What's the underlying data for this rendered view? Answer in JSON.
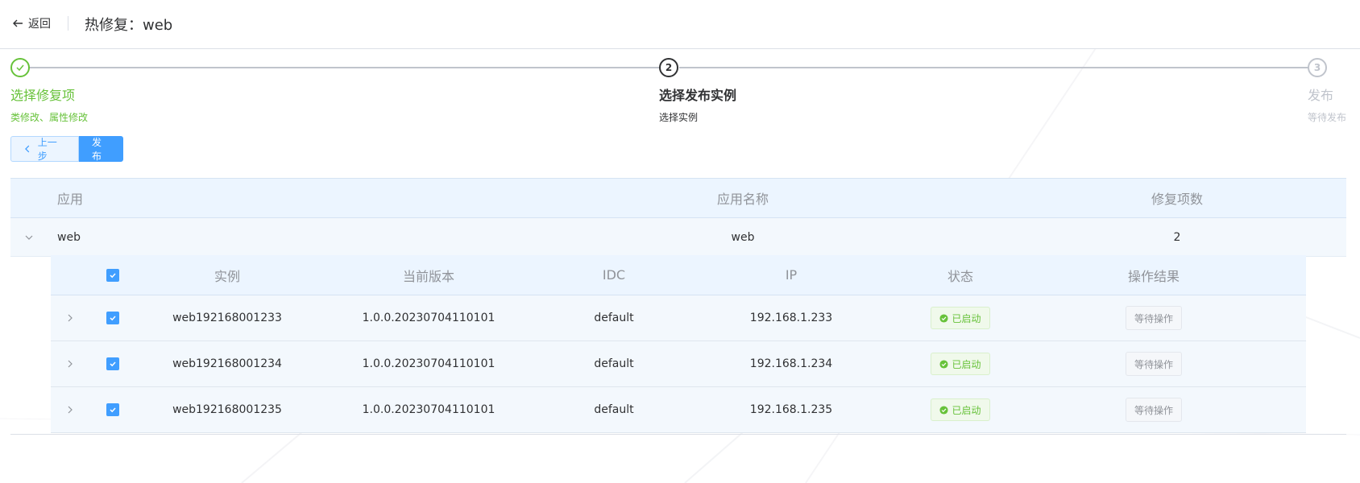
{
  "header": {
    "back_label": "返回",
    "title": "热修复：web"
  },
  "steps": [
    {
      "index": "1",
      "title": "选择修复项",
      "desc": "类修改、属性修改",
      "status": "done"
    },
    {
      "index": "2",
      "title": "选择发布实例",
      "desc": "选择实例",
      "status": "active"
    },
    {
      "index": "3",
      "title": "发布",
      "desc": "等待发布",
      "status": "wait"
    }
  ],
  "toolbar": {
    "prev_label": "上一步",
    "publish_label": "发布"
  },
  "app_table": {
    "columns": [
      "应用",
      "应用名称",
      "修复项数"
    ],
    "row": {
      "app": "web",
      "app_name": "web",
      "fix_count": "2"
    }
  },
  "instance_table": {
    "columns": [
      "实例",
      "当前版本",
      "IDC",
      "IP",
      "状态",
      "操作结果"
    ],
    "rows": [
      {
        "instance": "web192168001233",
        "version": "1.0.0.20230704110101",
        "idc": "default",
        "ip": "192.168.1.233",
        "status": "已启动",
        "result": "等待操作"
      },
      {
        "instance": "web192168001234",
        "version": "1.0.0.20230704110101",
        "idc": "default",
        "ip": "192.168.1.234",
        "status": "已启动",
        "result": "等待操作"
      },
      {
        "instance": "web192168001235",
        "version": "1.0.0.20230704110101",
        "idc": "default",
        "ip": "192.168.1.235",
        "status": "已启动",
        "result": "等待操作"
      }
    ]
  },
  "colors": {
    "success": "#67c23a",
    "primary": "#409eff",
    "header_bg": "#ecf5ff",
    "muted": "#909399"
  },
  "icons": {
    "back": "arrow-left-icon",
    "step_done": "check-icon",
    "prev": "chevron-left-icon",
    "collapse": "chevron-down-icon",
    "expand": "chevron-right-icon",
    "checkbox": "checkbox-checked-icon",
    "status": "check-circle-icon"
  }
}
